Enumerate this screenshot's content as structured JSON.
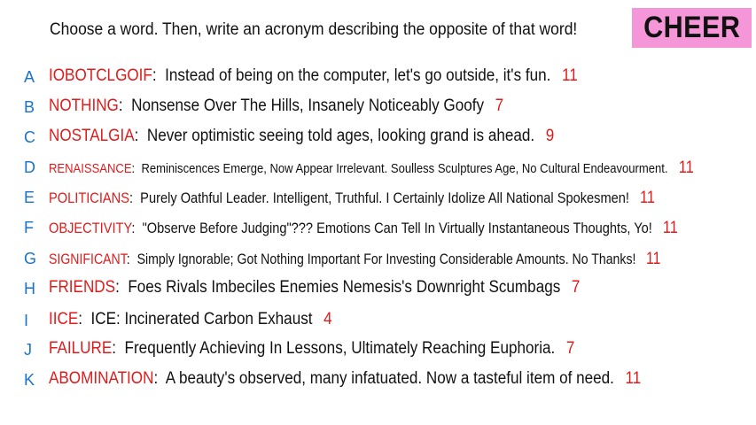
{
  "header": {
    "instruction": "Choose a word. Then, write an acronym describing the opposite of that word!",
    "badge": "CHEER"
  },
  "colors": {
    "letter": "#1a73c8",
    "word": "#e01b1b",
    "badge_bg": "#f596d8"
  },
  "entries": [
    {
      "letter": "A",
      "word": "IOBOTCLGOIF",
      "acronym": "Instead of being on the computer, let's go outside, it's fun.",
      "count": "11"
    },
    {
      "letter": "B",
      "word": "NOTHING",
      "acronym": "Nonsense Over The Hills, Insanely Noticeably Goofy",
      "count": "7"
    },
    {
      "letter": "C",
      "word": "NOSTALGIA",
      "acronym": "Never optimistic seeing told ages, looking grand is ahead.",
      "count": "9"
    },
    {
      "letter": "D",
      "word": "RENAISSANCE",
      "acronym": "Reminiscences Emerge, Now Appear Irrelevant. Soulless Sculptures Age, No Cultural Endeavourment.",
      "count": "11"
    },
    {
      "letter": "E",
      "word": "POLITICIANS",
      "acronym": "Purely Oathful Leader. Intelligent, Truthful. I Certainly Idolize All National Spokesmen!",
      "count": "11"
    },
    {
      "letter": "F",
      "word": "OBJECTIVITY",
      "acronym": "\"Observe Before Judging\"??? Emotions Can Tell In Virtually Instantaneous Thoughts, Yo!",
      "count": "11"
    },
    {
      "letter": "G",
      "word": "SIGNIFICANT",
      "acronym": "Simply Ignorable; Got Nothing Important For Investing Considerable Amounts. No Thanks!",
      "count": "11"
    },
    {
      "letter": "H",
      "word": "FRIENDS",
      "acronym": "Foes Rivals Imbeciles Enemies Nemesis's Downright Scumbags",
      "count": "7"
    },
    {
      "letter": "I",
      "word": "IICE",
      "acronym": "ICE: Incinerated Carbon Exhaust",
      "count": "4"
    },
    {
      "letter": "J",
      "word": "FAILURE",
      "acronym": "Frequently Achieving In Lessons, Ultimately Reaching Euphoria.",
      "count": "7"
    },
    {
      "letter": "K",
      "word": "ABOMINATION",
      "acronym": "A beauty's observed, many infatuated. Now a tasteful item of need.",
      "count": "11"
    }
  ]
}
